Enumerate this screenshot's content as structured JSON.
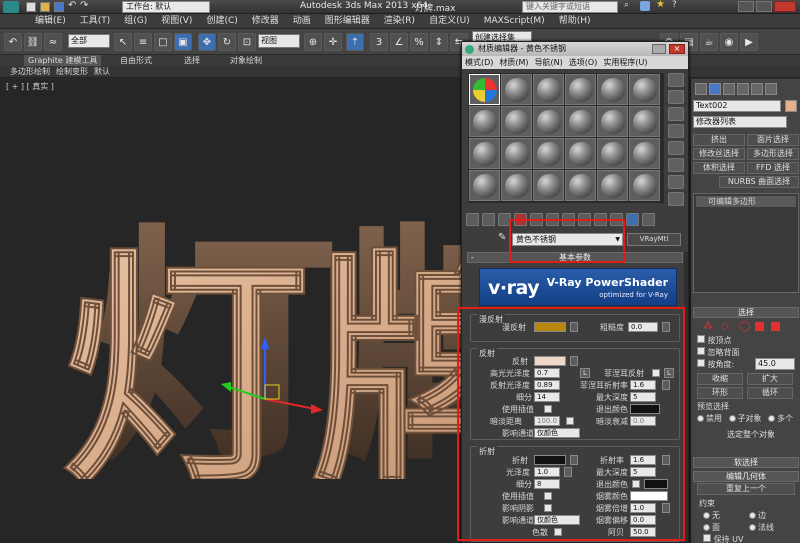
{
  "app": {
    "title": "Autodesk 3ds Max  2013 x64",
    "file": "灯牌.max",
    "workspace": "工作台: 默认",
    "search_placeholder": "键入关键字或短语"
  },
  "menu": [
    "编辑(E)",
    "工具(T)",
    "组(G)",
    "视图(V)",
    "创建(C)",
    "修改器",
    "动画",
    "图形编辑器",
    "渲染(R)",
    "自定义(U)",
    "MAXScript(M)",
    "帮助(H)"
  ],
  "toolbar": {
    "filter": "全部",
    "coord": "视图",
    "selection_set": "创建选择集"
  },
  "ribbon": {
    "tabs": [
      "Graphite 建模工具",
      "自由形式",
      "选择",
      "对象绘制"
    ],
    "sub": [
      "多边形绘制",
      "绘制变形",
      "默认"
    ]
  },
  "viewport": {
    "label": "[ + ] [ 真实 ]",
    "text3d": "灯牌"
  },
  "material_editor": {
    "title": "材质编辑器 - 黄色不锈钢",
    "menu": [
      "模式(D)",
      "材质(M)",
      "导航(N)",
      "选项(O)",
      "实用程序(U)"
    ],
    "material_name": "黄色不锈钢",
    "material_type": "VRayMtl",
    "rollout_basic": "基本参数",
    "vray_brand": "v·ray",
    "vray_powershader": "V-Ray PowerShader",
    "vray_optimized": "optimized for V-Ray",
    "diffuse": {
      "group": "漫反射",
      "label": "漫反射",
      "color": "#b8860b",
      "roughness_label": "粗糙度",
      "roughness": "0.0"
    },
    "reflection": {
      "group": "反射",
      "label": "反射",
      "color": "#f0d8c8",
      "hilight_label": "高光光泽度",
      "hilight": "0.7",
      "glossy_label": "反射光泽度",
      "glossy": "0.89",
      "subdivs_label": "细分",
      "subdivs": "14",
      "interp_label": "使用插值",
      "dim_label": "暗淡距离",
      "dim": "100.0",
      "affect_label": "影响通道",
      "affect": "仅颜色",
      "fresnel_label": "菲涅耳反射",
      "fresnel_ior_label": "菲涅耳折射率",
      "fresnel_ior": "1.6",
      "maxdepth_label": "最大深度",
      "maxdepth": "5",
      "exit_label": "退出颜色",
      "exit_color": "#111111",
      "dimfall_label": "暗淡衰减",
      "dimfall": "0.0",
      "l_label": "L"
    },
    "refraction": {
      "group": "折射",
      "label": "折射",
      "color": "#111111",
      "gloss_label": "光泽度",
      "gloss": "1.0",
      "subdivs_label": "细分",
      "subdivs": "8",
      "interp_label": "使用插值",
      "shadow_label": "影响阴影",
      "affect_label": "影响通道",
      "affect": "仅颜色",
      "ior_label": "折射率",
      "ior": "1.6",
      "maxdepth_label": "最大深度",
      "maxdepth": "5",
      "exit_label": "退出颜色",
      "fog_label": "烟雾颜色",
      "fog_color": "#ffffff",
      "fogmult_label": "烟雾倍增",
      "fogmult": "1.0",
      "fogbias_label": "烟雾偏移",
      "fogbias": "0.0",
      "disp_label": "色散",
      "abbe_label": "阿贝",
      "abbe": "50.0"
    }
  },
  "command_panel": {
    "object_name": "Text002",
    "modifier_list": "修改器列表",
    "buttons": [
      "挤出",
      "面片选择",
      "修改丝选择",
      "多边形选择",
      "体积选择",
      "FFD 选择",
      "NURBS 曲面选择"
    ],
    "stack_item": "可编辑多边形",
    "select_head": "选择",
    "by_vertex": "按顶点",
    "ignore_back": "忽略背面",
    "by_angle": "按角度:",
    "angle": "45.0",
    "shrink": "收缩",
    "grow": "扩大",
    "ring": "环形",
    "loop": "循环",
    "preview_head": "预览选择",
    "preview": [
      "禁用",
      "子对象",
      "多个"
    ],
    "whole_obj": "选定整个对象",
    "soft_head": "软选择",
    "edit_geom_head": "编辑几何体",
    "repeat_last": "重复上一个",
    "constraints": "约束",
    "constraint_opts": [
      "无",
      "边",
      "面",
      "法线"
    ],
    "keep_uv": "保持 UV"
  },
  "colors": {
    "accent_red": "#e41b1b",
    "text3d": "#d6a884"
  }
}
